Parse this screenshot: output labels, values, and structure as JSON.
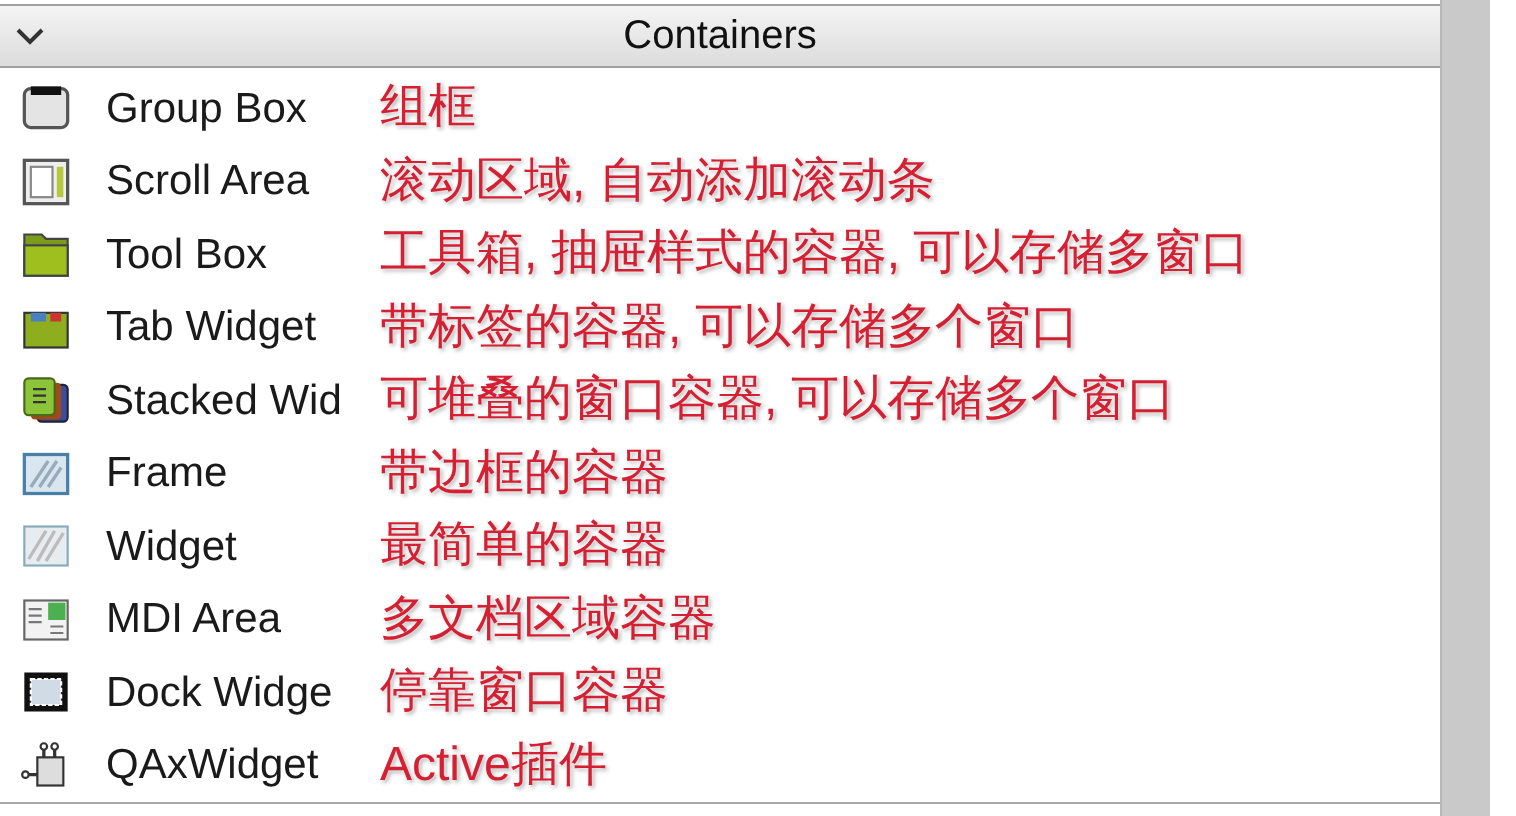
{
  "category": {
    "title": "Containers",
    "expanded": true
  },
  "widgets": [
    {
      "kind": "group-box",
      "name": "Group Box",
      "note": "组框"
    },
    {
      "kind": "scroll-area",
      "name": "Scroll Area",
      "note": "滚动区域, 自动添加滚动条"
    },
    {
      "kind": "tool-box",
      "name": "Tool Box",
      "note": "工具箱, 抽屉样式的容器, 可以存储多窗口"
    },
    {
      "kind": "tab-widget",
      "name": "Tab Widget",
      "note": "带标签的容器, 可以存储多个窗口"
    },
    {
      "kind": "stacked",
      "name": "Stacked Wid",
      "note": "可堆叠的窗口容器, 可以存储多个窗口"
    },
    {
      "kind": "frame",
      "name": "Frame",
      "note": "带边框的容器"
    },
    {
      "kind": "widget",
      "name": "Widget",
      "note": "最简单的容器"
    },
    {
      "kind": "mdi",
      "name": "MDI Area",
      "note": "多文档区域容器"
    },
    {
      "kind": "dock",
      "name": "Dock Widge",
      "note": "停靠窗口容器"
    },
    {
      "kind": "activex",
      "name": "QAxWidget",
      "note": "Active插件"
    }
  ]
}
